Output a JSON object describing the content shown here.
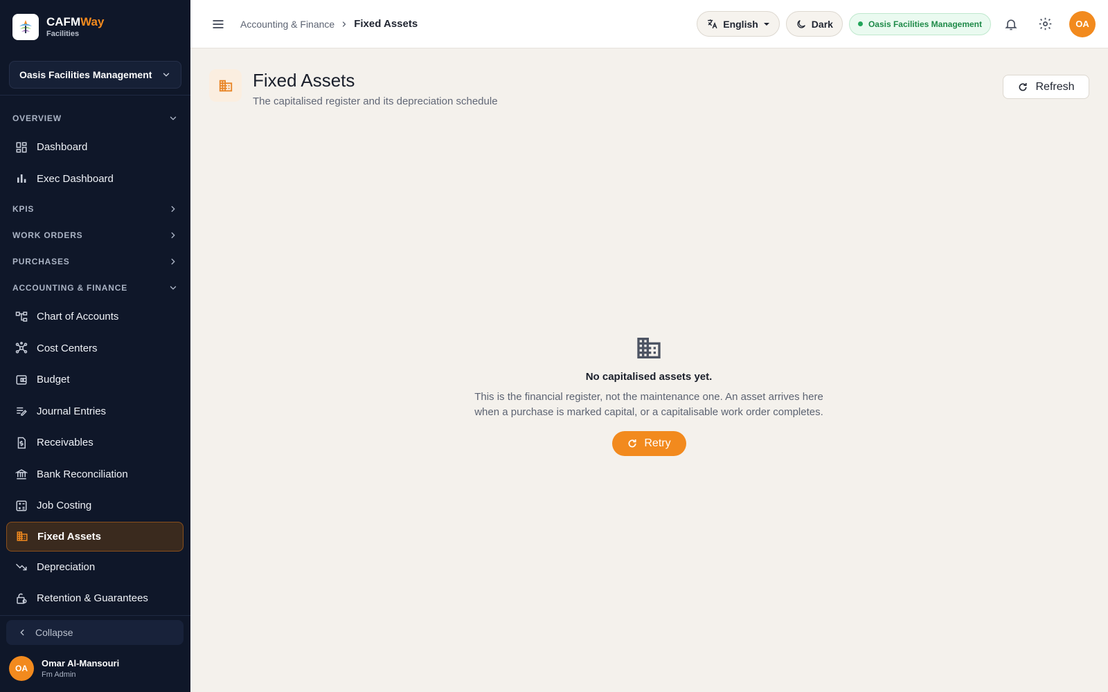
{
  "brand": {
    "name_main": "CAFM",
    "name_accent": "Way",
    "subtitle": "Facilities"
  },
  "org_selector": {
    "value": "Oasis Facilities Management"
  },
  "sidebar": {
    "sections": [
      {
        "label": "OVERVIEW",
        "expanded": true
      },
      {
        "label": "KPIS",
        "expanded": false
      },
      {
        "label": "WORK ORDERS",
        "expanded": false
      },
      {
        "label": "PURCHASES",
        "expanded": false
      },
      {
        "label": "ACCOUNTING & FINANCE",
        "expanded": true
      }
    ],
    "overview_items": [
      {
        "label": "Dashboard",
        "icon": "dashboard-icon"
      },
      {
        "label": "Exec Dashboard",
        "icon": "bar-chart-icon"
      }
    ],
    "finance_items": [
      {
        "label": "Chart of Accounts",
        "icon": "account-tree-icon"
      },
      {
        "label": "Cost Centers",
        "icon": "hub-icon"
      },
      {
        "label": "Budget",
        "icon": "wallet-icon"
      },
      {
        "label": "Journal Entries",
        "icon": "edit-note-icon"
      },
      {
        "label": "Receivables",
        "icon": "receipt-icon"
      },
      {
        "label": "Bank Reconciliation",
        "icon": "bank-icon"
      },
      {
        "label": "Job Costing",
        "icon": "calculator-icon"
      },
      {
        "label": "Fixed Assets",
        "icon": "domain-icon",
        "active": true
      },
      {
        "label": "Depreciation",
        "icon": "trending-down-icon"
      },
      {
        "label": "Retention & Guarantees",
        "icon": "lock-person-icon"
      }
    ],
    "collapse_label": "Collapse"
  },
  "user": {
    "initials": "OA",
    "name": "Omar Al-Mansouri",
    "role": "Fm Admin"
  },
  "topbar": {
    "breadcrumb_parent": "Accounting & Finance",
    "breadcrumb_current": "Fixed Assets",
    "language": "English",
    "theme_toggle": "Dark",
    "org_badge": "Oasis Facilities Management",
    "avatar_initials": "OA"
  },
  "page": {
    "title": "Fixed Assets",
    "subtitle": "The capitalised register and its depreciation schedule",
    "refresh_label": "Refresh"
  },
  "empty_state": {
    "title": "No capitalised assets yet.",
    "line1": "This is the financial register, not the maintenance one. An asset arrives here",
    "line2": "when a purchase is marked capital, or a capitalisable work order completes.",
    "retry_label": "Retry"
  },
  "colors": {
    "accent": "#f28a1e",
    "sidebar_bg": "#0f1729",
    "page_bg": "#f4f1ec",
    "status_green": "#22a55a"
  }
}
